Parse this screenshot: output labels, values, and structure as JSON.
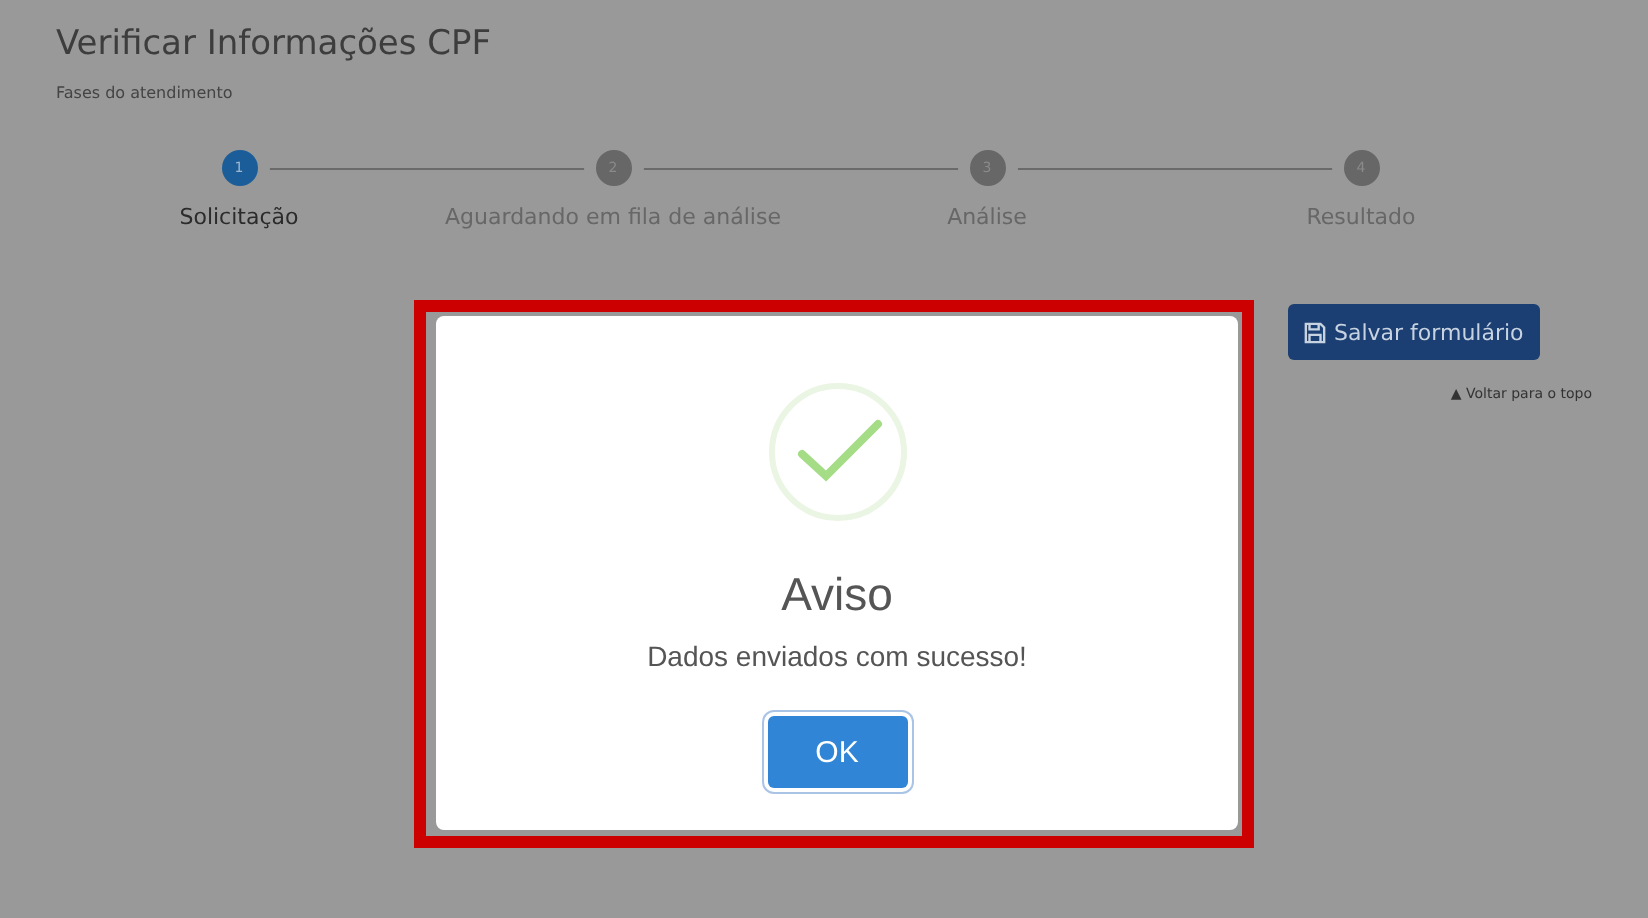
{
  "page": {
    "title": "Verificar Informações CPF",
    "subtitle": "Fases do atendimento"
  },
  "steps": [
    {
      "number": "1",
      "label": "Solicitação",
      "selected": true
    },
    {
      "number": "2",
      "label": "Aguardando em fila de análise",
      "selected": false
    },
    {
      "number": "3",
      "label": "Análise",
      "selected": false
    },
    {
      "number": "4",
      "label": "Resultado",
      "selected": false
    }
  ],
  "save_button": {
    "label": "Salvar formulário"
  },
  "back_to_top": {
    "icon": "▲",
    "label": "Voltar para o topo"
  },
  "dialog": {
    "title": "Aviso",
    "message": "Dados enviados com sucesso!",
    "button": "OK",
    "highlighted": true
  }
}
